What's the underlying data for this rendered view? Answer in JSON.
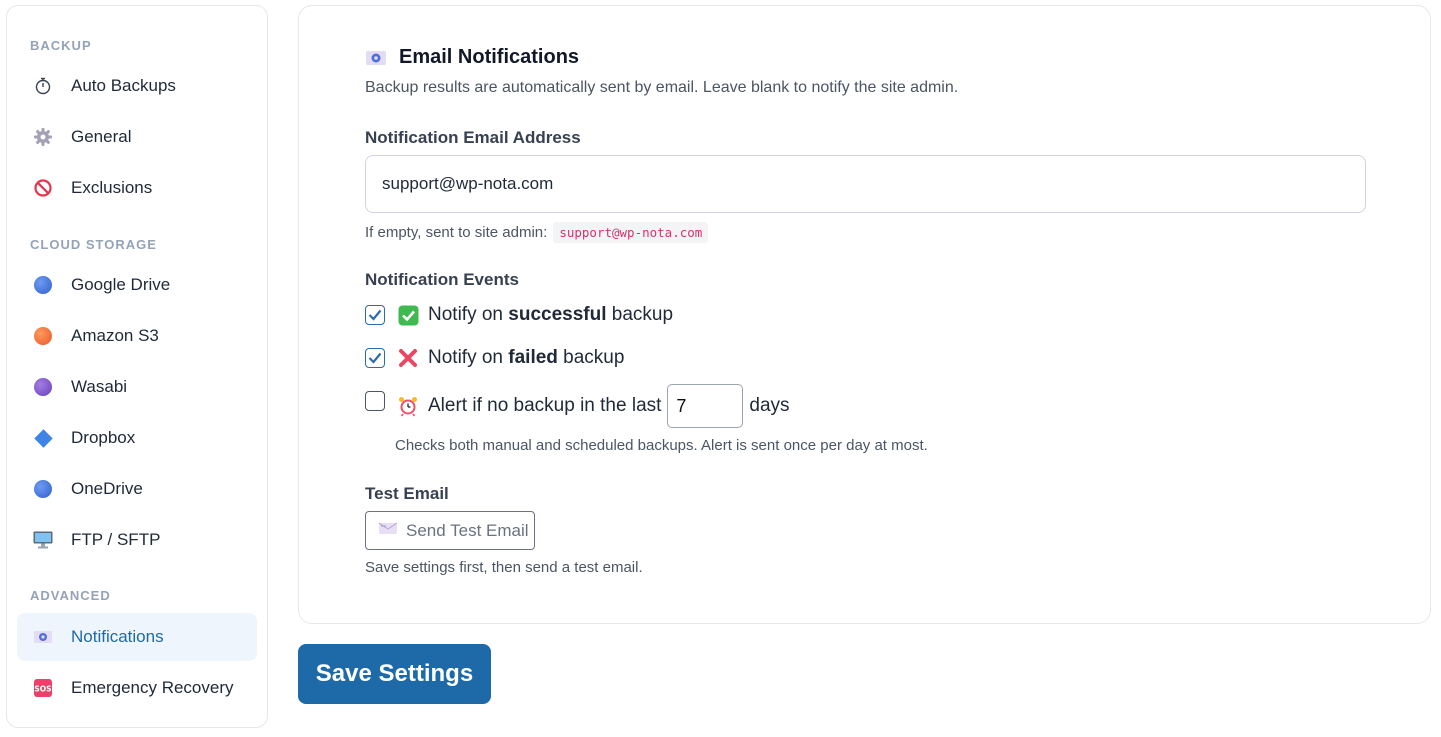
{
  "sidebar": {
    "sections": [
      {
        "title": "BACKUP"
      },
      {
        "title": "CLOUD STORAGE"
      },
      {
        "title": "ADVANCED"
      }
    ],
    "items": [
      {
        "label": "Auto Backups",
        "icon": "stopwatch-icon"
      },
      {
        "label": "General",
        "icon": "gear-icon"
      },
      {
        "label": "Exclusions",
        "icon": "prohibited-icon"
      },
      {
        "label": "Google Drive",
        "icon": "blue-circle-icon"
      },
      {
        "label": "Amazon S3",
        "icon": "orange-circle-icon"
      },
      {
        "label": "Wasabi",
        "icon": "purple-circle-icon"
      },
      {
        "label": "Dropbox",
        "icon": "blue-diamond-icon"
      },
      {
        "label": "OneDrive",
        "icon": "blue-circle-icon"
      },
      {
        "label": "FTP / SFTP",
        "icon": "desktop-computer-icon"
      },
      {
        "label": "Notifications",
        "icon": "email-icon",
        "active": true
      },
      {
        "label": "Emergency Recovery",
        "icon": "sos-icon"
      }
    ]
  },
  "main": {
    "heading": "Email Notifications",
    "description": "Backup results are automatically sent by email. Leave blank to notify the site admin.",
    "email_label": "Notification Email Address",
    "email_value": "support@wp-nota.com",
    "email_hint": "If empty, sent to site admin:",
    "email_hint_code": "support@wp-nota.com",
    "events_label": "Notification Events",
    "events": [
      {
        "prefix": "Notify on ",
        "bold": "successful",
        "suffix": " backup",
        "checked": true,
        "icon": "check-mark-button-icon"
      },
      {
        "prefix": "Notify on ",
        "bold": "failed",
        "suffix": " backup",
        "checked": true,
        "icon": "cross-mark-icon"
      }
    ],
    "alert": {
      "prefix": "Alert if no backup in the last",
      "days_value": "7",
      "suffix": "days",
      "checked": false,
      "icon": "alarm-clock-icon",
      "hint": "Checks both manual and scheduled backups. Alert is sent once per day at most."
    },
    "test_label": "Test Email",
    "test_button": "Send Test Email",
    "test_hint": "Save settings first, then send a test email."
  },
  "save_button": "Save Settings",
  "colors": {
    "accent": "#1e6aa8",
    "active_bg": "#eef5fc",
    "section_title": "#94a3b8",
    "code_text": "#d6336c"
  }
}
